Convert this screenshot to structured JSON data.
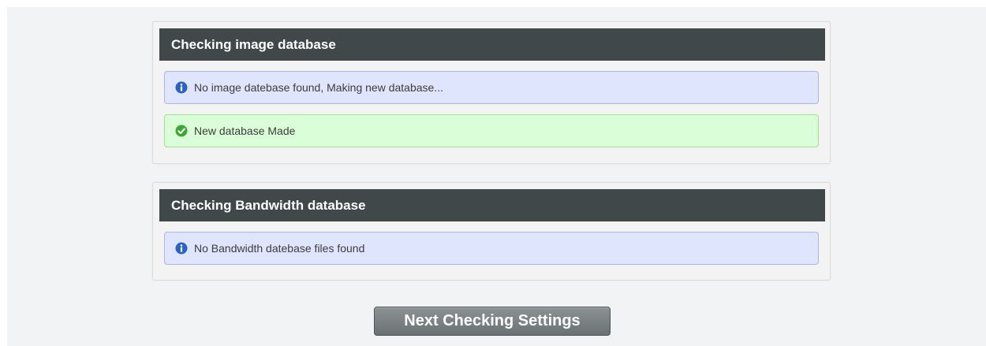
{
  "sections": [
    {
      "title": "Checking image database",
      "messages": [
        {
          "type": "info",
          "icon": "info-icon",
          "text": "No image datebase found, Making new database..."
        },
        {
          "type": "success",
          "icon": "check-circle-icon",
          "text": "New database Made"
        }
      ]
    },
    {
      "title": "Checking Bandwidth database",
      "messages": [
        {
          "type": "info",
          "icon": "info-icon",
          "text": "No Bandwidth datebase files found"
        }
      ]
    }
  ],
  "actions": {
    "next_label": "Next Checking Settings"
  },
  "colors": {
    "header_bg": "#414849",
    "info_bg": "#dfe5fd",
    "info_icon": "#2a63c7",
    "success_bg": "#dafed7",
    "success_icon": "#3ea836",
    "button_bg": "#7b8183"
  }
}
